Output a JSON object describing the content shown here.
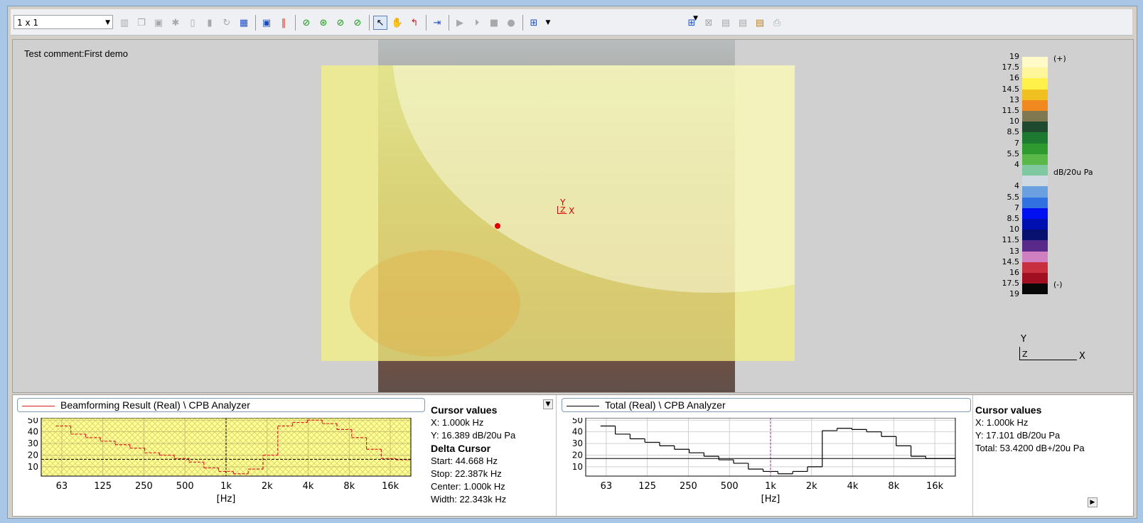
{
  "toolbar": {
    "layout_value": "1 x 1",
    "colors": {
      "accent_green": "#1a9a1a",
      "accent_blue": "#2050c0"
    }
  },
  "main": {
    "comment": "Test comment:First demo",
    "axis_red": {
      "y": "Y",
      "z": "Z",
      "x": "X"
    },
    "axis_bottom": {
      "y": "Y",
      "z": "Z",
      "x": "X"
    }
  },
  "legend": {
    "plus": "(+)",
    "minus": "(-)",
    "unit": "dB/20u Pa",
    "rows": [
      {
        "label": "19",
        "color": "#fffac8"
      },
      {
        "label": "17.5",
        "color": "#fff59a"
      },
      {
        "label": "16",
        "color": "#fff04a"
      },
      {
        "label": "14.5",
        "color": "#f0c020"
      },
      {
        "label": "13",
        "color": "#f08a20"
      },
      {
        "label": "11.5",
        "color": "#807850"
      },
      {
        "label": "10",
        "color": "#204a30"
      },
      {
        "label": "8.5",
        "color": "#1e7a30"
      },
      {
        "label": "7",
        "color": "#2e9a30"
      },
      {
        "label": "5.5",
        "color": "#5ab84a"
      },
      {
        "label": "4",
        "color": "#80c8a0"
      },
      {
        "label": "4",
        "color": "#d0d8e0"
      },
      {
        "label": "5.5",
        "color": "#6aa0e0"
      },
      {
        "label": "7",
        "color": "#3070e0"
      },
      {
        "label": "8.5",
        "color": "#0010f0"
      },
      {
        "label": "10",
        "color": "#0010b0"
      },
      {
        "label": "11.5",
        "color": "#081070"
      },
      {
        "label": "13",
        "color": "#5a2a8a"
      },
      {
        "label": "14.5",
        "color": "#d080c0"
      },
      {
        "label": "16",
        "color": "#c83040"
      },
      {
        "label": "17.5",
        "color": "#a01020"
      },
      {
        "label": "19",
        "color": "#080808"
      }
    ]
  },
  "left_panel": {
    "title": "Beamforming Result (Real) \\ CPB Analyzer",
    "cursor": {
      "heading": "Cursor values",
      "x": "X: 1.000k Hz",
      "y": "Y: 16.389 dB/20u Pa",
      "delta_heading": "Delta Cursor",
      "start": "Start: 44.668 Hz",
      "stop": "Stop: 22.387k Hz",
      "center": "Center: 1.000k Hz",
      "width": "Width: 22.343k Hz"
    }
  },
  "right_panel": {
    "title": "Total (Real) \\ CPB Analyzer",
    "cursor": {
      "heading": "Cursor values",
      "x": "X: 1.000k Hz",
      "y": "Y: 17.101 dB/20u Pa",
      "total": "Total: 53.4200 dB+/20u Pa"
    }
  },
  "chart_data": [
    {
      "type": "line",
      "title": "Beamforming Result (Real) \\ CPB Analyzer",
      "xlabel": "[Hz]",
      "ylabel": "",
      "x_ticks": [
        "63",
        "125",
        "250",
        "500",
        "1k",
        "2k",
        "4k",
        "8k",
        "16k"
      ],
      "y_ticks": [
        10,
        20,
        30,
        40,
        50
      ],
      "ylim": [
        2,
        52
      ],
      "grid": true,
      "series": [
        {
          "values": [
            null,
            45,
            38,
            35,
            32,
            29,
            26,
            22,
            20,
            17,
            14,
            9,
            6,
            4,
            8,
            20,
            45,
            48,
            50,
            47,
            42,
            35,
            25,
            17,
            16
          ]
        }
      ]
    },
    {
      "type": "line",
      "title": "Total (Real) \\ CPB Analyzer",
      "xlabel": "[Hz]",
      "ylabel": "",
      "x_ticks": [
        "63",
        "125",
        "250",
        "500",
        "1k",
        "2k",
        "4k",
        "8k",
        "16k"
      ],
      "y_ticks": [
        10,
        20,
        30,
        40,
        50
      ],
      "ylim": [
        2,
        52
      ],
      "grid": true,
      "series": [
        {
          "values": [
            null,
            45,
            38,
            34,
            31,
            28,
            25,
            22,
            19,
            16,
            13,
            8,
            6,
            4,
            6,
            10,
            41,
            43,
            42,
            40,
            36,
            28,
            19,
            17,
            17
          ]
        }
      ]
    }
  ]
}
